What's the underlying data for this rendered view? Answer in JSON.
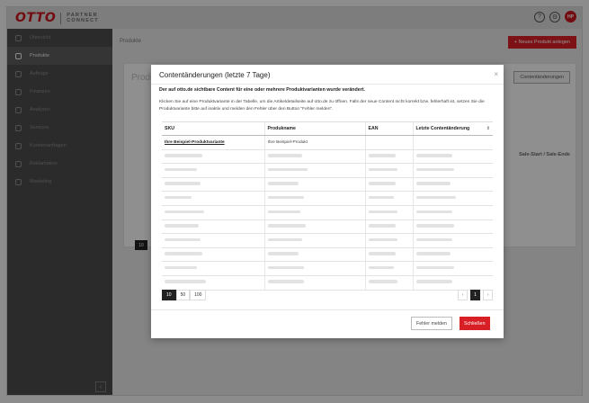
{
  "app": {
    "brand": "OTTO",
    "brand_sub_line1": "PARTNER",
    "brand_sub_line2": "CONNECT",
    "user_initials": "HP"
  },
  "sidebar": {
    "items": [
      {
        "label": "Übersicht"
      },
      {
        "label": "Produkte"
      },
      {
        "label": "Aufträge"
      },
      {
        "label": "Finanzen"
      },
      {
        "label": "Analysen"
      },
      {
        "label": "Services"
      },
      {
        "label": "Kundenanfragen"
      },
      {
        "label": "Reklamation"
      },
      {
        "label": "Marketing"
      }
    ],
    "active_index": 1,
    "collapse_icon": "chevron-left-icon"
  },
  "main": {
    "breadcrumb": "Produkte",
    "new_product_button": "+ Neues Produkt anlegen",
    "bg_title": "Produkte",
    "bg_content_changes_button": "Contentänderungen",
    "bg_sale_column": "Sale-Start / Sale-Ende",
    "bg_page_size": "10"
  },
  "modal": {
    "title": "Contentänderungen (letzte 7 Tage)",
    "close_icon": "×",
    "subtitle": "Der auf otto.de sichtbare Content für eine oder mehrere Produktvarianten wurde verändert.",
    "description": "Klicken Sie auf eine Produktvariante in der Tabelle, um die Artikeldetailseite auf otto.de zu öffnen. Falls der neue Content nicht korrekt bzw. fehlerhaft ist, setzen Sie die Produktvariante bitte auf inaktiv und melden den Fehler über den Button \"Fehler melden\".",
    "table": {
      "columns": [
        "SKU",
        "Produkname",
        "EAN",
        "Letzte Contentänderung"
      ],
      "first_row": {
        "sku": "Ihre Beispiel-Produktvariante",
        "name": "Ihre Beispiel-Produkt"
      }
    },
    "page_sizes": [
      "10",
      "50",
      "100"
    ],
    "current_page": "1",
    "report_button": "Fehler melden",
    "close_button": "Schließen"
  },
  "colors": {
    "accent": "#d81f26",
    "sidebar_bg": "#4a4a4a"
  }
}
